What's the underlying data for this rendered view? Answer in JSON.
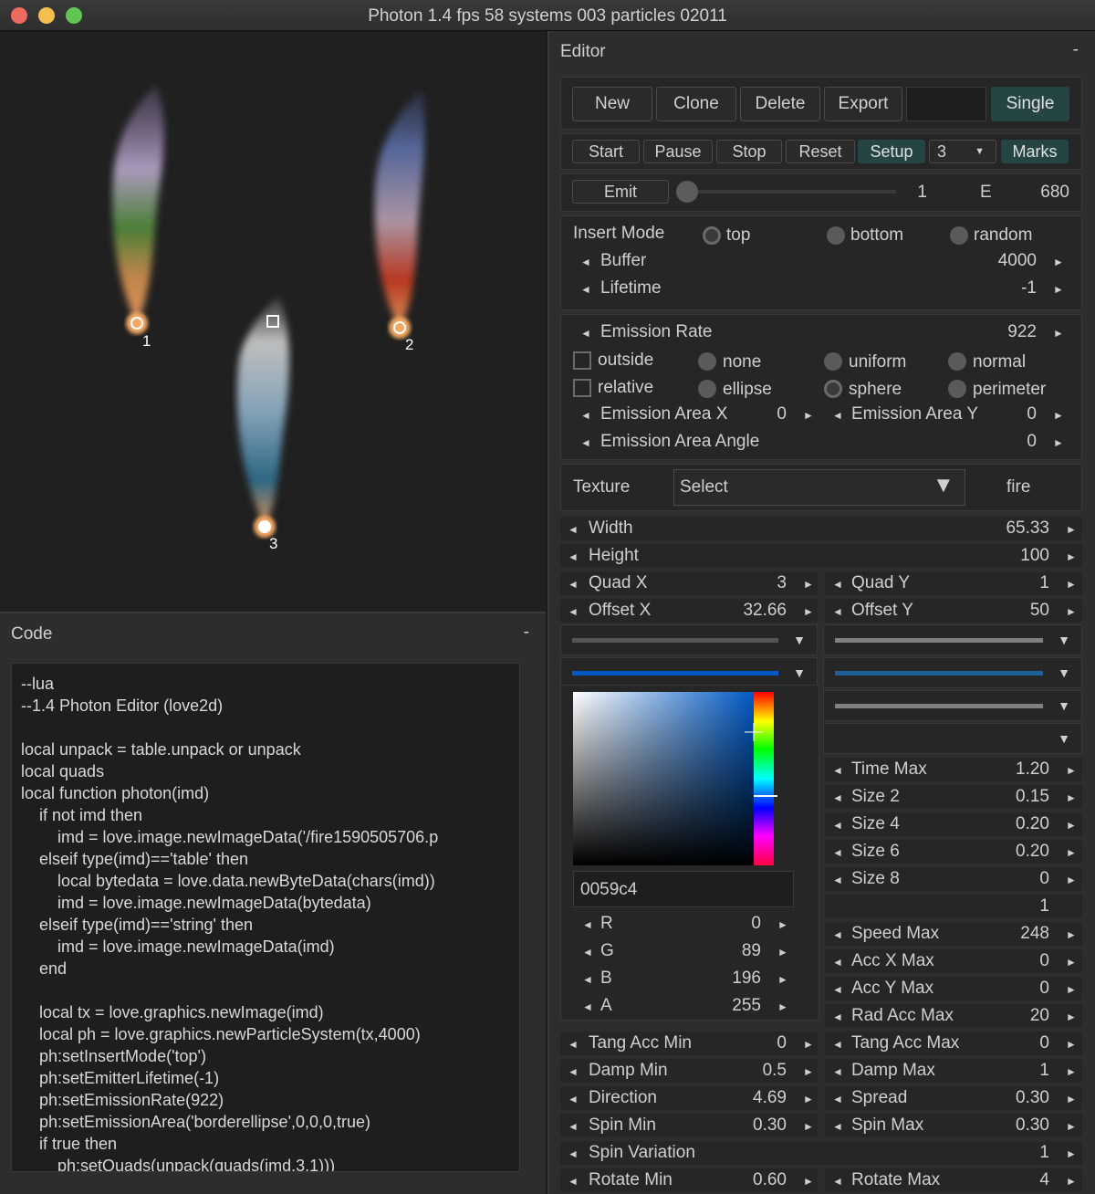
{
  "window": {
    "title": "Photon 1.4 fps 58 systems 003 particles 02011"
  },
  "viewport": {
    "emitters": [
      "1",
      "2",
      "3"
    ]
  },
  "code": {
    "title": "Code",
    "minimize": "-",
    "lines": [
      "--lua",
      "--1.4 Photon Editor (love2d)",
      "",
      "local unpack = table.unpack or unpack",
      "local quads",
      "local function photon(imd)",
      "    if not imd then",
      "        imd = love.image.newImageData('/fire1590505706.p",
      "    elseif type(imd)=='table' then",
      "        local bytedata = love.data.newByteData(chars(imd))",
      "        imd = love.image.newImageData(bytedata)",
      "    elseif type(imd)=='string' then",
      "        imd = love.image.newImageData(imd)",
      "    end",
      "",
      "    local tx = love.graphics.newImage(imd)",
      "    local ph = love.graphics.newParticleSystem(tx,4000)",
      "    ph:setInsertMode('top')",
      "    ph:setEmitterLifetime(-1)",
      "    ph:setEmissionRate(922)",
      "    ph:setEmissionArea('borderellipse',0,0,0,true)",
      "    if true then",
      "        ph:setQuads(unpack(quads(imd,3,1)))"
    ]
  },
  "editor": {
    "title": "Editor",
    "minimize": "-",
    "buttons": {
      "new": "New",
      "clone": "Clone",
      "delete": "Delete",
      "export": "Export",
      "single": "Single"
    },
    "controls": {
      "start": "Start",
      "pause": "Pause",
      "stop": "Stop",
      "reset": "Reset",
      "setup": "Setup",
      "count": "3",
      "marks": "Marks"
    },
    "emit": {
      "label": "Emit",
      "count": "1",
      "e_label": "E",
      "e_value": "680"
    },
    "insert_mode": {
      "label": "Insert Mode",
      "options": [
        "top",
        "bottom",
        "random"
      ],
      "selected": "top"
    },
    "buffer": {
      "label": "Buffer",
      "value": "4000"
    },
    "lifetime": {
      "label": "Lifetime",
      "value": "-1"
    },
    "emission_rate": {
      "label": "Emission Rate",
      "value": "922"
    },
    "outside_label": "outside",
    "relative_label": "relative",
    "area_types": [
      "none",
      "uniform",
      "normal",
      "ellipse",
      "sphere",
      "perimeter"
    ],
    "area_selected": "sphere",
    "emission_area_x": {
      "label": "Emission Area X",
      "value": "0"
    },
    "emission_area_y": {
      "label": "Emission Area Y",
      "value": "0"
    },
    "emission_area_angle": {
      "label": "Emission Area Angle",
      "value": "0"
    },
    "texture": {
      "label": "Texture",
      "select": "Select",
      "name": "fire"
    },
    "width": {
      "label": "Width",
      "value": "65.33"
    },
    "height": {
      "label": "Height",
      "value": "100"
    },
    "quad_x": {
      "label": "Quad X",
      "value": "3"
    },
    "quad_y": {
      "label": "Quad Y",
      "value": "1"
    },
    "offset_x": {
      "label": "Offset X",
      "value": "32.66"
    },
    "offset_y": {
      "label": "Offset Y",
      "value": "50"
    },
    "color_hex": "0059c4",
    "rgba": [
      {
        "label": "R",
        "value": "0"
      },
      {
        "label": "G",
        "value": "89"
      },
      {
        "label": "B",
        "value": "196"
      },
      {
        "label": "A",
        "value": "255"
      }
    ],
    "right_params": [
      {
        "label": "Time Max",
        "value": "1.20"
      },
      {
        "label": "Size 2",
        "value": "0.15"
      },
      {
        "label": "Size 4",
        "value": "0.20"
      },
      {
        "label": "Size 6",
        "value": "0.20"
      },
      {
        "label": "Size 8",
        "value": "0"
      },
      {
        "label": "",
        "value": "1"
      },
      {
        "label": "Speed Max",
        "value": "248"
      },
      {
        "label": "Acc X Max",
        "value": "0"
      },
      {
        "label": "Acc Y Max",
        "value": "0"
      },
      {
        "label": "Rad Acc Max",
        "value": "20"
      }
    ],
    "bottom_params": [
      {
        "left": {
          "label": "Tang Acc Min",
          "value": "0"
        },
        "right": {
          "label": "Tang Acc Max",
          "value": "0"
        }
      },
      {
        "left": {
          "label": "Damp Min",
          "value": "0.5"
        },
        "right": {
          "label": "Damp Max",
          "value": "1"
        }
      },
      {
        "left": {
          "label": "Direction",
          "value": "4.69"
        },
        "right": {
          "label": "Spread",
          "value": "0.30"
        }
      },
      {
        "left": {
          "label": "Spin Min",
          "value": "0.30"
        },
        "right": {
          "label": "Spin Max",
          "value": "0.30"
        }
      }
    ],
    "spin_variation": {
      "label": "Spin Variation",
      "value": "1"
    },
    "rotate_min": {
      "label": "Rotate Min",
      "value": "0.60"
    },
    "rotate_max": {
      "label": "Rotate Max",
      "value": "4"
    },
    "colors": {
      "accent": "#254545",
      "gradient_blue": "#0059c4",
      "gradient_blue2": "#1f5f9a",
      "gray_line": "#808080"
    }
  }
}
